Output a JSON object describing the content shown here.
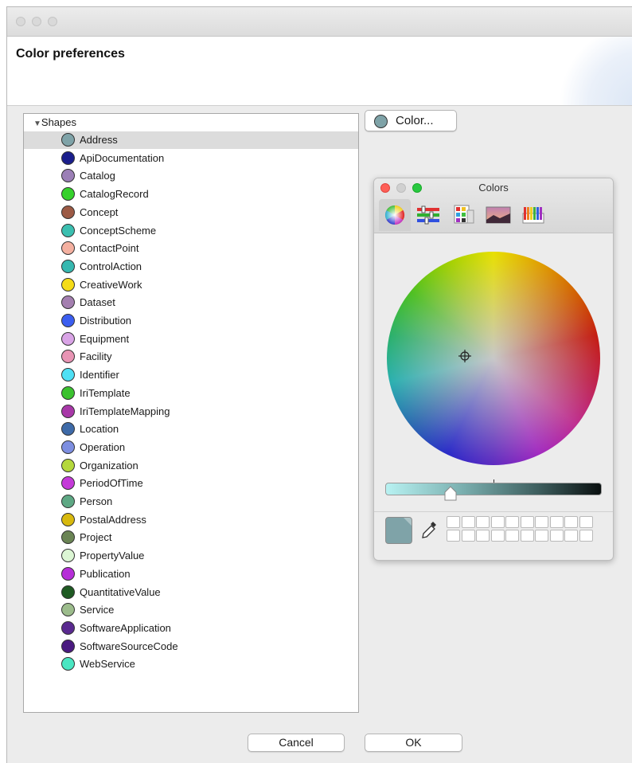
{
  "window": {
    "header_title": "Color preferences"
  },
  "tree": {
    "root_label": "Shapes",
    "selected_index": 0,
    "items": [
      {
        "label": "Address",
        "color": "#7fa3a8"
      },
      {
        "label": "ApiDocumentation",
        "color": "#1a1e8c"
      },
      {
        "label": "Catalog",
        "color": "#9b7fb6"
      },
      {
        "label": "CatalogRecord",
        "color": "#35d12b"
      },
      {
        "label": "Concept",
        "color": "#9c5a45"
      },
      {
        "label": "ConceptScheme",
        "color": "#3bbfb0"
      },
      {
        "label": "ContactPoint",
        "color": "#f4b0a0"
      },
      {
        "label": "ControlAction",
        "color": "#36b8b0"
      },
      {
        "label": "CreativeWork",
        "color": "#f5dc18"
      },
      {
        "label": "Dataset",
        "color": "#a47fb0"
      },
      {
        "label": "Distribution",
        "color": "#3b5ef0"
      },
      {
        "label": "Equipment",
        "color": "#d9a4e6"
      },
      {
        "label": "Facility",
        "color": "#e894b4"
      },
      {
        "label": "Identifier",
        "color": "#4fe0f5"
      },
      {
        "label": "IriTemplate",
        "color": "#3bc22f"
      },
      {
        "label": "IriTemplateMapping",
        "color": "#a838a8"
      },
      {
        "label": "Location",
        "color": "#3e6aa8"
      },
      {
        "label": "Operation",
        "color": "#7d8ee0"
      },
      {
        "label": "Organization",
        "color": "#b4d83c"
      },
      {
        "label": "PeriodOfTime",
        "color": "#c43ad8"
      },
      {
        "label": "Person",
        "color": "#5ea884"
      },
      {
        "label": "PostalAddress",
        "color": "#d8b90e"
      },
      {
        "label": "Project",
        "color": "#6a8454"
      },
      {
        "label": "PropertyValue",
        "color": "#dcf6d4"
      },
      {
        "label": "Publication",
        "color": "#b62ed8"
      },
      {
        "label": "QuantitativeValue",
        "color": "#1e5a22"
      },
      {
        "label": "Service",
        "color": "#9cbc8c"
      },
      {
        "label": "SoftwareApplication",
        "color": "#5a2a90"
      },
      {
        "label": "SoftwareSourceCode",
        "color": "#4a1a80"
      },
      {
        "label": "WebService",
        "color": "#4ae6c2"
      }
    ]
  },
  "color_button": {
    "label": "Color...",
    "color": "#7fa3a8"
  },
  "colors_panel": {
    "title": "Colors",
    "modes": [
      "color-wheel-icon",
      "color-sliders-icon",
      "color-palettes-icon",
      "image-palettes-icon",
      "pencils-icon"
    ],
    "selected_mode": 0,
    "current_color": "#7fa3a8",
    "brightness": 0.3
  },
  "buttons": {
    "cancel": "Cancel",
    "ok": "OK"
  }
}
